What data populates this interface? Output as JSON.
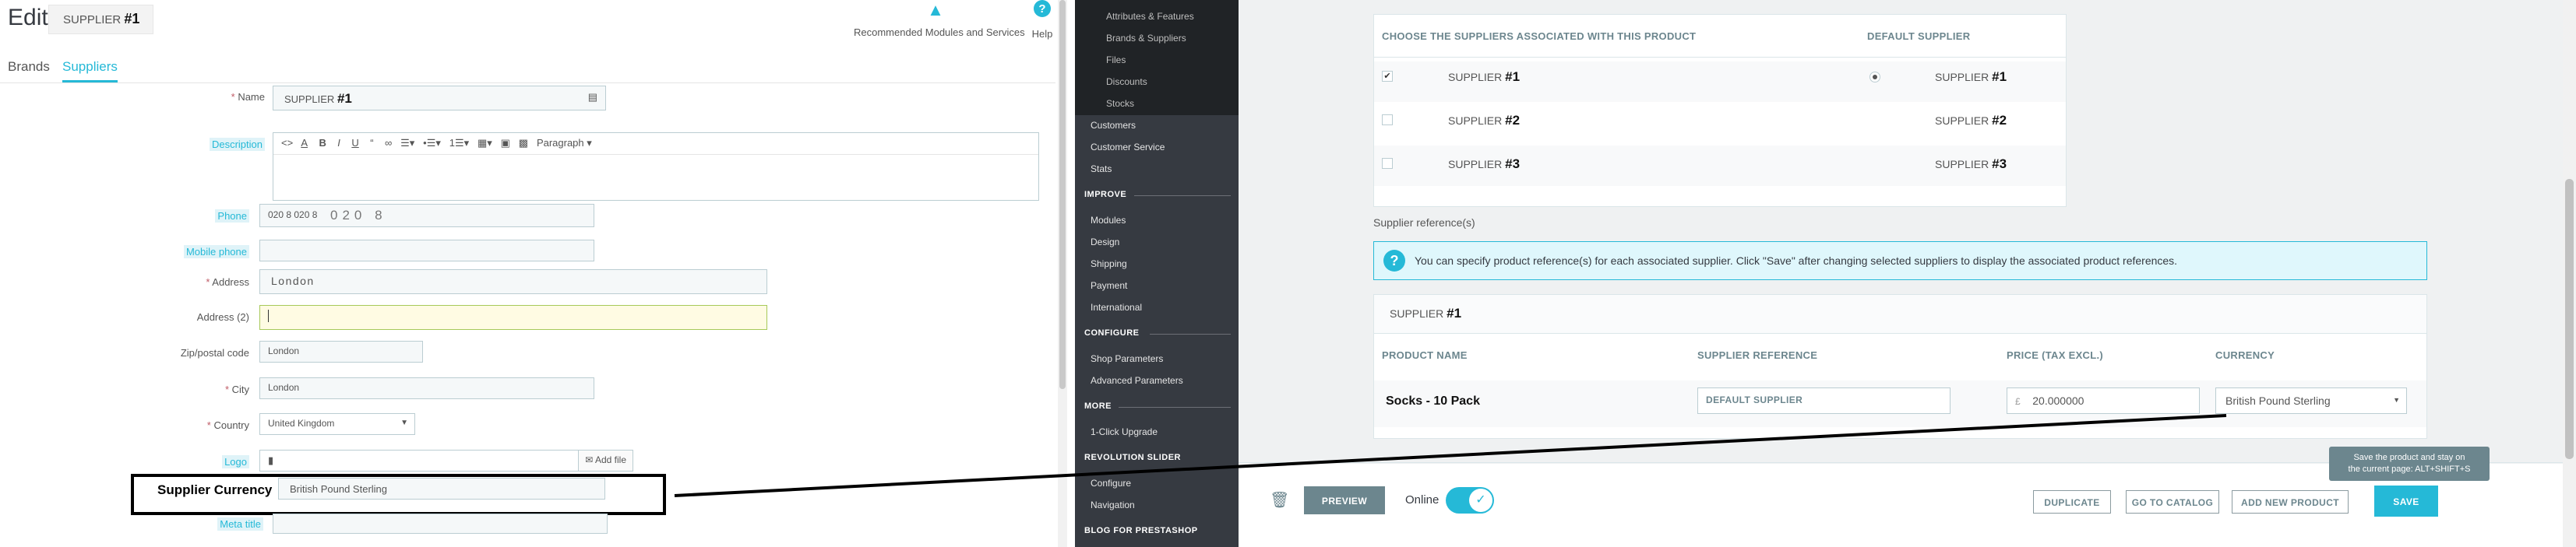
{
  "header": {
    "edit_label": "Edit:",
    "supplier_name": "SUPPLIER",
    "supplier_num": "#1",
    "toolbar": {
      "modules_label": "Recommended Modules and Services",
      "help_label": "Help"
    }
  },
  "tabs": [
    {
      "label": "Brands"
    },
    {
      "label": "Suppliers"
    }
  ],
  "form": {
    "name_label": "Name",
    "name_value": "SUPPLIER",
    "name_num": "#1",
    "description_label": "Description",
    "editor_paragraph": "Paragraph",
    "phone_label": "Phone",
    "phone_value": "020 8  020 8",
    "phone_overlay": "020 8",
    "mobile_label": "Mobile phone",
    "address_label": "Address",
    "address_value": "London",
    "address2_label": "Address (2)",
    "zip_label": "Zip/postal code",
    "zip_value": "London",
    "city_label": "City",
    "city_value": "London",
    "country_label": "Country",
    "country_value": "United Kingdom",
    "logo_label": "Logo",
    "add_file": "Add file",
    "supplier_currency_label": "Supplier Currency",
    "supplier_currency_value": "British Pound Sterling",
    "meta_title_label": "Meta title"
  },
  "sidebar": {
    "catalog_sub": [
      "Attributes & Features",
      "Brands & Suppliers",
      "Files",
      "Discounts",
      "Stocks"
    ],
    "top_items": [
      "Customers",
      "Customer Service",
      "Stats"
    ],
    "improve_label": "IMPROVE",
    "improve_items": [
      "Modules",
      "Design",
      "Shipping",
      "Payment",
      "International"
    ],
    "configure_label": "CONFIGURE",
    "configure_items": [
      "Shop Parameters",
      "Advanced Parameters"
    ],
    "more_label": "MORE",
    "more_items": [
      "1-Click Upgrade"
    ],
    "revslider_label": "REVOLUTION SLIDER",
    "revslider_items": [
      "Configure",
      "Navigation"
    ],
    "blog_label": "BLOG FOR PRESTASHOP"
  },
  "suppliers_box": {
    "header_choose": "CHOOSE THE SUPPLIERS ASSOCIATED WITH THIS PRODUCT",
    "header_default": "DEFAULT SUPPLIER",
    "rows": [
      {
        "name": "SUPPLIER",
        "num": "#1",
        "checked": true,
        "default": true
      },
      {
        "name": "SUPPLIER",
        "num": "#2",
        "checked": false,
        "default": false
      },
      {
        "name": "SUPPLIER",
        "num": "#3",
        "checked": false,
        "default": false
      }
    ],
    "check_glyph": "✔"
  },
  "references": {
    "title": "Supplier reference(s)",
    "info_text": "You can specify product reference(s) for each associated supplier. Click \"Save\" after changing selected suppliers to display the associated product references.",
    "info_icon": "question-icon",
    "supplier_name": "SUPPLIER",
    "supplier_num": "#1",
    "col_product": "PRODUCT NAME",
    "col_reference": "SUPPLIER REFERENCE",
    "col_price": "PRICE (TAX EXCL.)",
    "col_currency": "CURRENCY",
    "product_name": "Socks - 10 Pack",
    "reference_value": "DEFAULT SUPPLIER",
    "price_symbol": "£",
    "price_value": "20.000000",
    "currency_value": "British Pound Sterling"
  },
  "footer": {
    "preview": "PREVIEW",
    "online": "Online",
    "online_enabled": true,
    "duplicate": "DUPLICATE",
    "go_to_catalog": "GO TO CATALOG",
    "add_new_product": "ADD NEW PRODUCT",
    "save": "SAVE",
    "tooltip_line1": "Save the product and stay on",
    "tooltip_line2": "the current page: ALT+SHIFT+S"
  },
  "colors": {
    "accent": "#25b9d7",
    "sidebar": "#363a41",
    "annotation": "#000000"
  }
}
